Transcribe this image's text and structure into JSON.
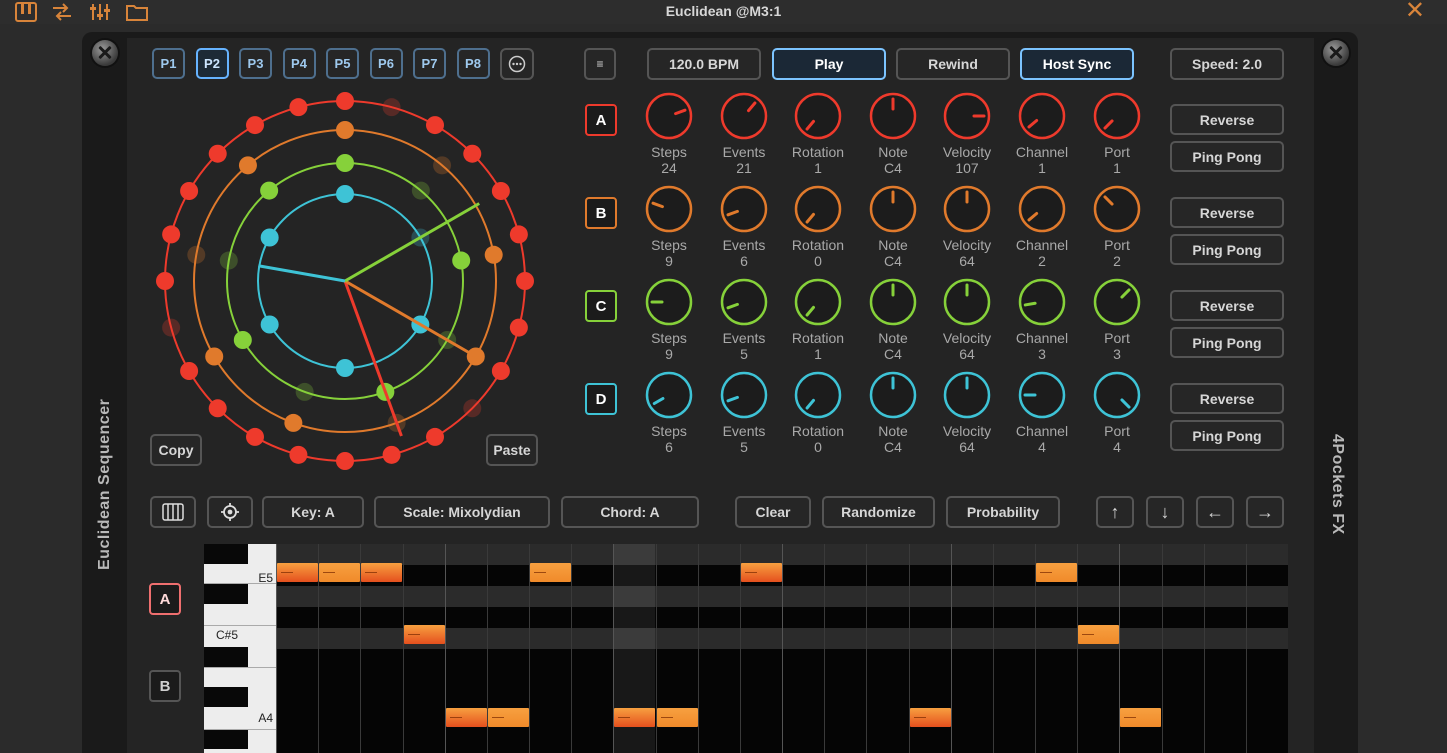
{
  "window": {
    "title": "Euclidean @M3:1",
    "close_glyph": "✕"
  },
  "host_toolbar": [
    {
      "name": "piano-keys-icon",
      "glyph": "🎹"
    },
    {
      "name": "routing-icon",
      "glyph": "⇄"
    },
    {
      "name": "mixer-sliders-icon",
      "glyph": "☰"
    },
    {
      "name": "folder-icon",
      "glyph": "🗀"
    }
  ],
  "side_labels": {
    "left": "Euclidean Sequencer",
    "right": "4Pockets FX"
  },
  "presets": [
    "P1",
    "P2",
    "P3",
    "P4",
    "P5",
    "P6",
    "P7",
    "P8"
  ],
  "active_preset": "P2",
  "more_button": "···",
  "menu_button": "≡",
  "transport": {
    "bpm": "120.0 BPM",
    "play": "Play",
    "rewind": "Rewind",
    "host_sync": "Host Sync",
    "speed": "Speed: 2.0"
  },
  "circle_buttons": {
    "copy": "Copy",
    "paste": "Paste"
  },
  "knob_labels": [
    "Steps",
    "Events",
    "Rotation",
    "Note",
    "Velocity",
    "Channel",
    "Port"
  ],
  "tracks": [
    {
      "id": "A",
      "color": "#ee3a2c",
      "values": [
        "24",
        "21",
        "1",
        "C4",
        "107",
        "1",
        "1"
      ],
      "steps": 24,
      "events": 21,
      "reverse": "Reverse",
      "pingpong": "Ping Pong"
    },
    {
      "id": "B",
      "color": "#e07a2c",
      "values": [
        "9",
        "6",
        "0",
        "C4",
        "64",
        "2",
        "2"
      ],
      "steps": 9,
      "events": 6,
      "reverse": "Reverse",
      "pingpong": "Ping Pong"
    },
    {
      "id": "C",
      "color": "#86d13a",
      "values": [
        "9",
        "5",
        "1",
        "C4",
        "64",
        "3",
        "3"
      ],
      "steps": 9,
      "events": 5,
      "reverse": "Reverse",
      "pingpong": "Ping Pong"
    },
    {
      "id": "D",
      "color": "#3ec3d6",
      "values": [
        "6",
        "5",
        "0",
        "C4",
        "64",
        "4",
        "4"
      ],
      "steps": 6,
      "events": 5,
      "reverse": "Reverse",
      "pingpong": "Ping Pong"
    }
  ],
  "roll_toolbar": {
    "key": "Key: A",
    "scale": "Scale: Mixolydian",
    "chord": "Chord: A",
    "clear": "Clear",
    "randomize": "Randomize",
    "probability": "Probability",
    "arrows": [
      "↑",
      "↓",
      "←",
      "→"
    ]
  },
  "roll_tracks": [
    "A",
    "B"
  ],
  "piano_labels": [
    "E5",
    "C#5",
    "A4"
  ],
  "roll_notes": [
    {
      "lane": 0,
      "cols": [
        0,
        1,
        2,
        6,
        11,
        18
      ]
    },
    {
      "lane": 3,
      "cols": [
        3,
        19
      ]
    },
    {
      "lane": 8,
      "cols": [
        4,
        5,
        8,
        9,
        15,
        20
      ]
    }
  ],
  "colors": {
    "accent_blue": "#66b3ff",
    "note_orange": "#f08a2a",
    "note_red": "#e5501e"
  }
}
